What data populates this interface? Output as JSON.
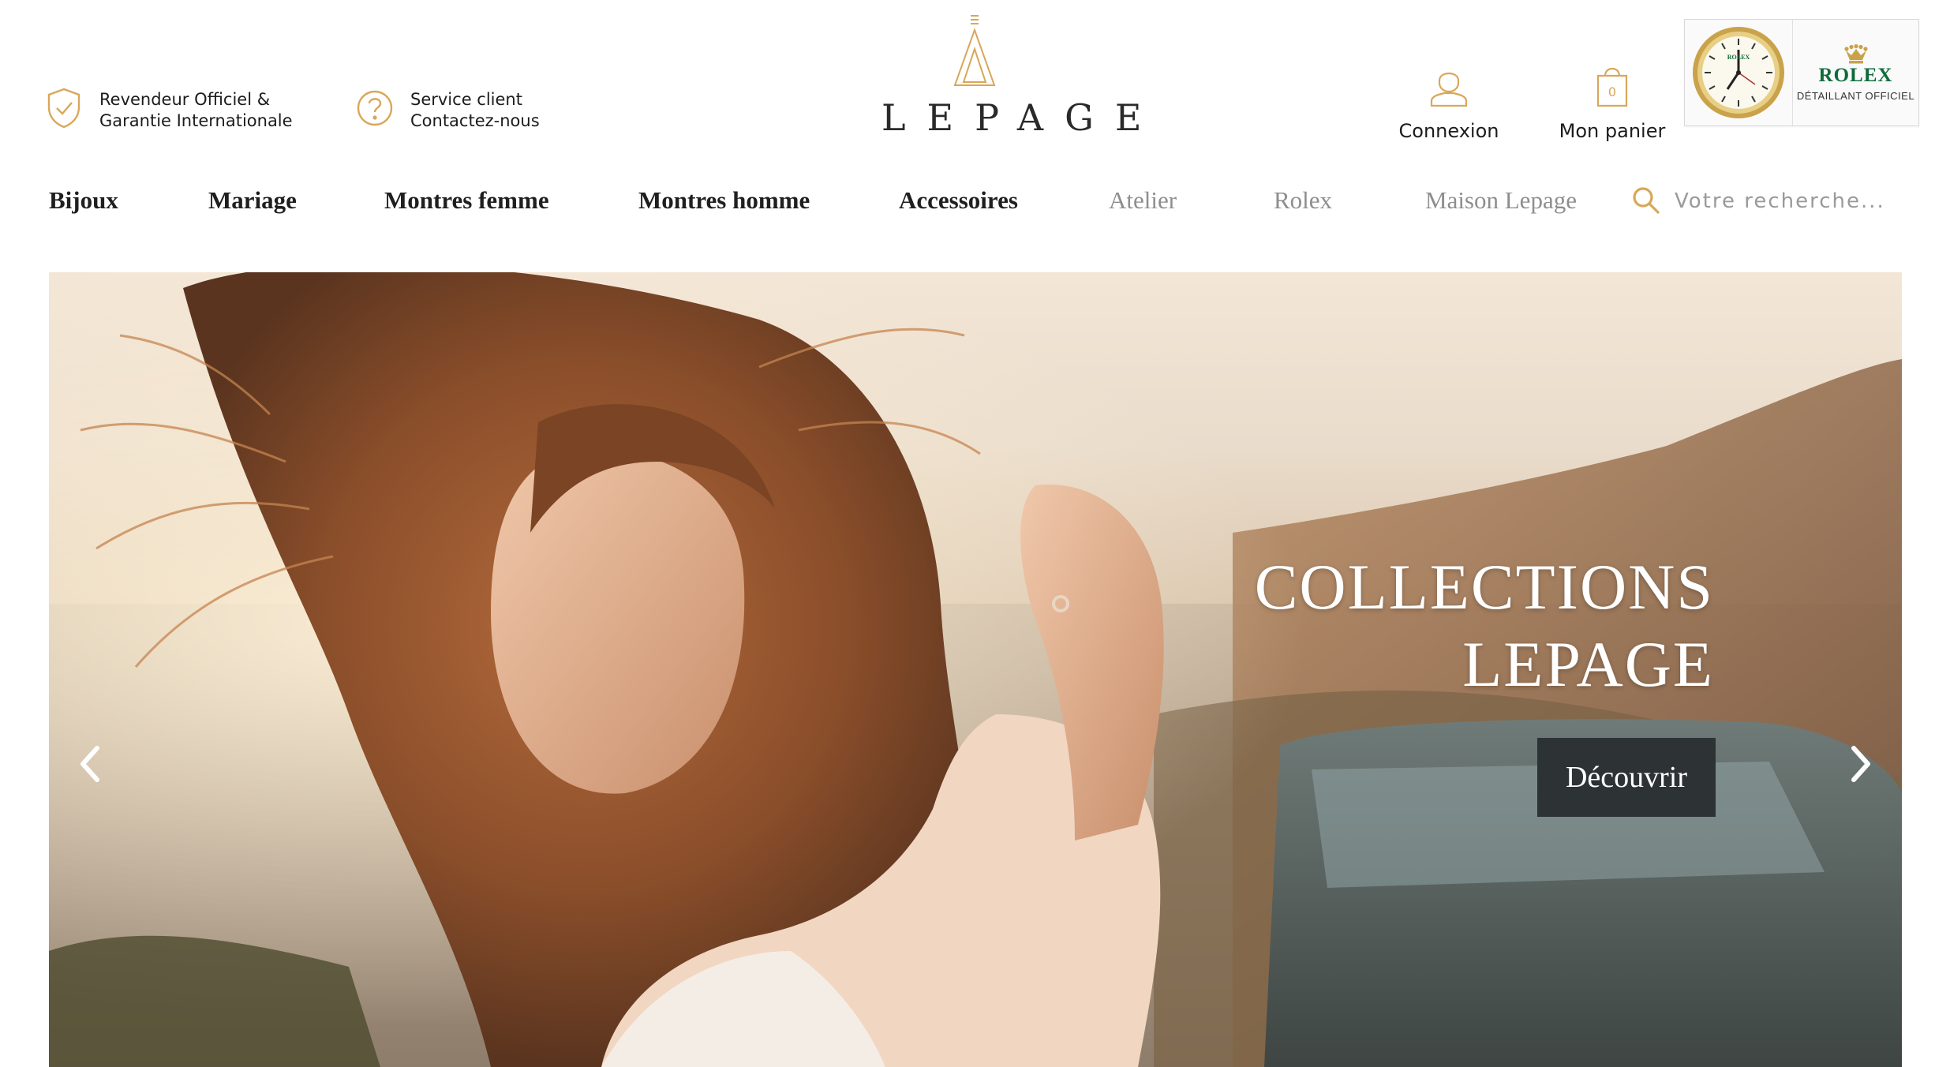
{
  "header": {
    "trust_badges": [
      {
        "icon": "shield-check-icon",
        "line1": "Revendeur Officiel &",
        "line2": "Garantie Internationale"
      },
      {
        "icon": "question-circle-icon",
        "line1": "Service client",
        "line2": "Contactez-nous"
      }
    ],
    "logo": {
      "word": "LEPAGE",
      "icon": "lepage-triangle-logo"
    },
    "account": {
      "icon": "user-icon",
      "label": "Connexion"
    },
    "cart": {
      "icon": "shopping-bag-icon",
      "label": "Mon panier",
      "count": "0"
    },
    "rolex_badge": {
      "brand": "ROLEX",
      "subtitle": "DÉTAILLANT OFFICIEL",
      "clock_text": "ROLEX",
      "crown_icon": "rolex-crown-icon"
    }
  },
  "nav": {
    "main_items": [
      "Bijoux",
      "Mariage",
      "Montres femme",
      "Montres homme",
      "Accessoires"
    ],
    "secondary_items": [
      "Atelier",
      "Rolex",
      "Maison Lepage"
    ],
    "search_placeholder": "Votre recherche..."
  },
  "hero": {
    "title_line1": "COLLECTIONS",
    "title_line2": "LEPAGE",
    "cta_label": "Découvrir",
    "prev_icon": "chevron-left-icon",
    "next_icon": "chevron-right-icon"
  },
  "colors": {
    "gold_accent": "#d9a75a",
    "rolex_green": "#0e6b3a",
    "cta_background": "#2d3235",
    "nav_secondary": "#8e8e8e"
  }
}
